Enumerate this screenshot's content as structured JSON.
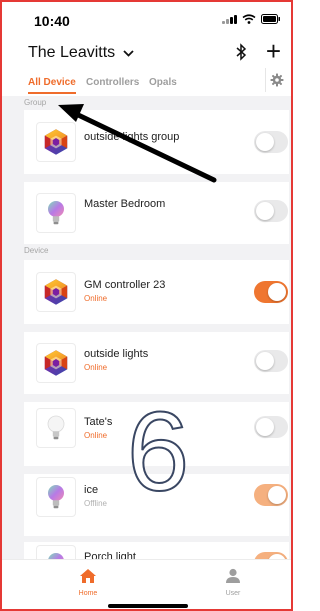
{
  "status_bar": {
    "time": "10:40"
  },
  "header": {
    "home_name": "The Leavitts"
  },
  "tabs": [
    {
      "label": "All Device",
      "active": true
    },
    {
      "label": "Controllers",
      "active": false
    },
    {
      "label": "Opals",
      "active": false
    }
  ],
  "sections": {
    "group": "Group",
    "device": "Device"
  },
  "groups": [
    {
      "name": "outside lights group",
      "icon": "controller-hexagon-icon",
      "toggle_on": false
    },
    {
      "name": "Master Bedroom",
      "icon": "color-bulb-icon",
      "toggle_on": false
    }
  ],
  "devices": [
    {
      "name": "GM controller 23",
      "status": "Online",
      "icon": "controller-hexagon-icon",
      "toggle_on": true
    },
    {
      "name": "outside lights",
      "status": "Online",
      "icon": "controller-hexagon-icon",
      "toggle_on": false
    },
    {
      "name": "Tate's",
      "status": "Online",
      "icon": "white-bulb-icon",
      "toggle_on": false
    },
    {
      "name": "ice",
      "status": "Offline",
      "icon": "color-bulb-icon",
      "toggle_on": true
    },
    {
      "name": "Porch light",
      "status": "",
      "icon": "color-bulb-icon",
      "toggle_on": true
    }
  ],
  "tabbar": {
    "home": "Home",
    "user": "User"
  },
  "annotation": {
    "number": "6"
  },
  "colors": {
    "accent": "#ef6c2b",
    "frame": "#e53935",
    "arrow": "#000000"
  }
}
